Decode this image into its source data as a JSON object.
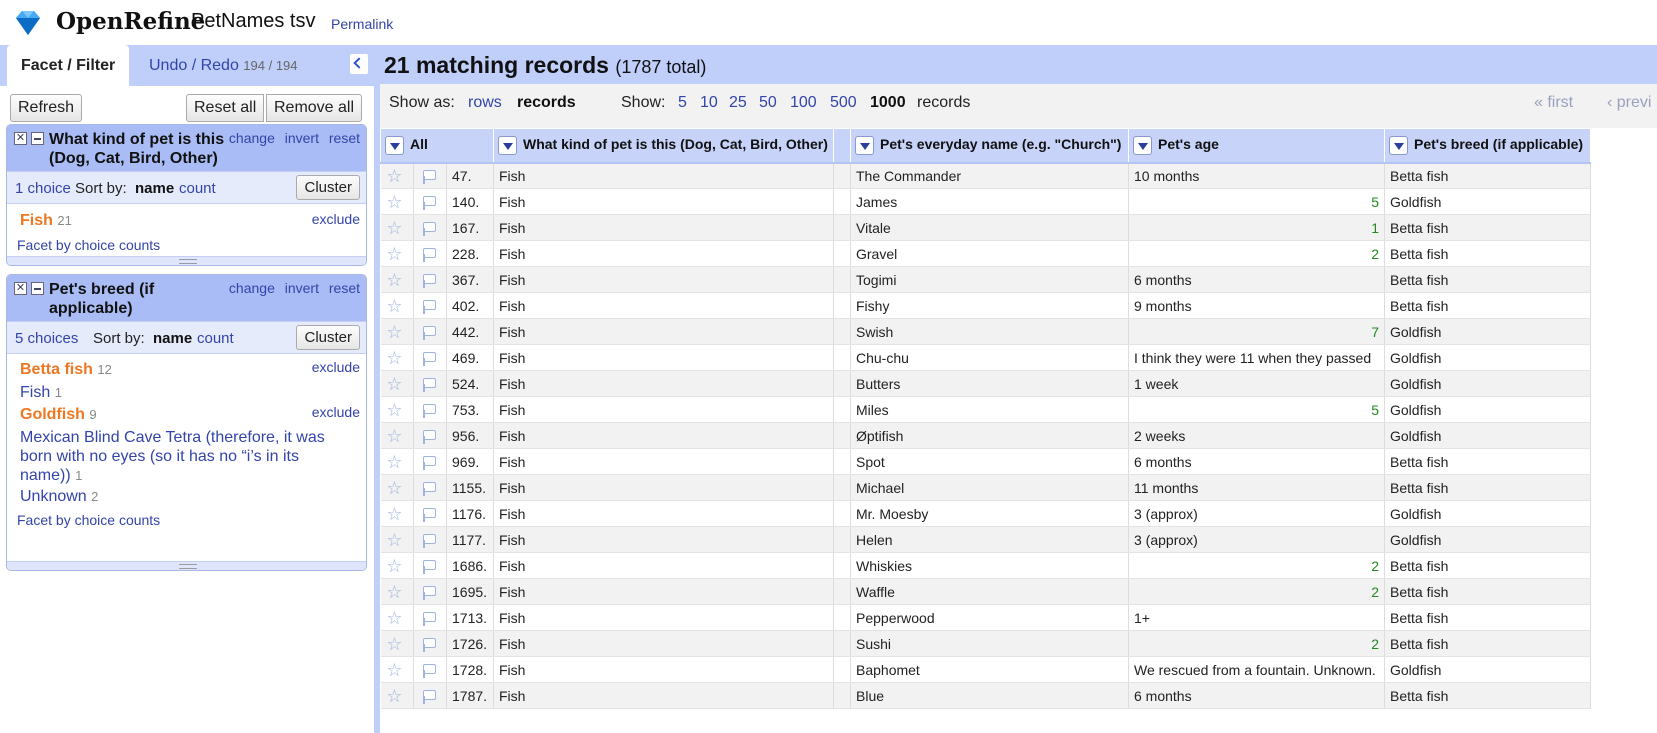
{
  "header": {
    "app_name": "OpenRefine",
    "project_name": "PetNames tsv",
    "permalink": "Permalink"
  },
  "left_panel": {
    "tabs": {
      "facet": "Facet / Filter",
      "undo": "Undo / Redo",
      "undo_count": "194 / 194"
    },
    "refresh": "Refresh",
    "reset_all": "Reset all",
    "remove_all": "Remove all",
    "facets": [
      {
        "title": "What kind of pet is this (Dog, Cat, Bird, Other)",
        "links": {
          "change": "change",
          "invert": "invert",
          "reset": "reset"
        },
        "choice_count": "1 choice",
        "sort_by": "Sort by:",
        "sort_name": "name",
        "sort_count": "count",
        "cluster": "Cluster",
        "choices": [
          {
            "label": "Fish",
            "count": "21",
            "exclude": "exclude"
          }
        ],
        "facet_by_counts": "Facet by choice counts"
      },
      {
        "title": "Pet's breed (if applicable)",
        "links": {
          "change": "change",
          "invert": "invert",
          "reset": "reset"
        },
        "choice_count": "5 choices",
        "sort_by": "Sort by:",
        "sort_name": "name",
        "sort_count": "count",
        "cluster": "Cluster",
        "choices": [
          {
            "label": "Betta fish",
            "count": "12",
            "exclude": "exclude"
          },
          {
            "label": "Fish",
            "count": "1"
          },
          {
            "label": "Goldfish",
            "count": "9",
            "exclude": "exclude"
          },
          {
            "label": "Mexican Blind Cave Tetra (therefore, it was born with no eyes (so it has no “i’s in its name))",
            "count": "1"
          },
          {
            "label": "Unknown",
            "count": "2"
          }
        ],
        "facet_by_counts": "Facet by choice counts"
      }
    ]
  },
  "summary": {
    "count": "21 matching records",
    "total": "(1787 total)"
  },
  "view_bar": {
    "show_as": "Show as:",
    "rows": "rows",
    "records": "records",
    "show": "Show:",
    "page_sizes": [
      "5",
      "10",
      "25",
      "50",
      "100",
      "500",
      "1000"
    ],
    "records_label": "records",
    "first": "« first",
    "prev": "‹ previ"
  },
  "grid": {
    "all": "All",
    "columns": [
      "What kind of pet is this (Dog, Cat, Bird, Other)",
      "Pet's everyday name (e.g. \"Church\")",
      "Pet's age",
      "Pet's breed (if applicable)"
    ],
    "rows": [
      {
        "n": "47.",
        "kind": "Fish",
        "name": "The Commander",
        "age": "10 months",
        "age_num": false,
        "breed": "Betta fish"
      },
      {
        "n": "140.",
        "kind": "Fish",
        "name": "James",
        "age": "5",
        "age_num": true,
        "breed": "Goldfish"
      },
      {
        "n": "167.",
        "kind": "Fish",
        "name": "Vitale",
        "age": "1",
        "age_num": true,
        "breed": "Betta fish"
      },
      {
        "n": "228.",
        "kind": "Fish",
        "name": "Gravel",
        "age": "2",
        "age_num": true,
        "breed": "Betta fish"
      },
      {
        "n": "367.",
        "kind": "Fish",
        "name": "Togimi",
        "age": "6 months",
        "age_num": false,
        "breed": "Betta fish"
      },
      {
        "n": "402.",
        "kind": "Fish",
        "name": "Fishy",
        "age": "9 months",
        "age_num": false,
        "breed": "Betta fish"
      },
      {
        "n": "442.",
        "kind": "Fish",
        "name": "Swish",
        "age": "7",
        "age_num": true,
        "breed": "Goldfish"
      },
      {
        "n": "469.",
        "kind": "Fish",
        "name": "Chu-chu",
        "age": "I think they were 11 when they passed",
        "age_num": false,
        "breed": "Goldfish"
      },
      {
        "n": "524.",
        "kind": "Fish",
        "name": "Butters",
        "age": "1 week",
        "age_num": false,
        "breed": "Goldfish"
      },
      {
        "n": "753.",
        "kind": "Fish",
        "name": "Miles",
        "age": "5",
        "age_num": true,
        "breed": "Goldfish"
      },
      {
        "n": "956.",
        "kind": "Fish",
        "name": "Øptifish",
        "age": "2 weeks",
        "age_num": false,
        "breed": "Goldfish"
      },
      {
        "n": "969.",
        "kind": "Fish",
        "name": "Spot",
        "age": "6 months",
        "age_num": false,
        "breed": "Betta fish"
      },
      {
        "n": "1155.",
        "kind": "Fish",
        "name": "Michael",
        "age": "11 months",
        "age_num": false,
        "breed": "Betta fish"
      },
      {
        "n": "1176.",
        "kind": "Fish",
        "name": "Mr. Moesby",
        "age": "3  (approx)",
        "age_num": false,
        "breed": "Goldfish"
      },
      {
        "n": "1177.",
        "kind": "Fish",
        "name": "Helen",
        "age": "3  (approx)",
        "age_num": false,
        "breed": "Goldfish"
      },
      {
        "n": "1686.",
        "kind": "Fish",
        "name": "Whiskies",
        "age": "2",
        "age_num": true,
        "breed": "Betta fish"
      },
      {
        "n": "1695.",
        "kind": "Fish",
        "name": "Waffle",
        "age": "2",
        "age_num": true,
        "breed": "Betta fish"
      },
      {
        "n": "1713.",
        "kind": "Fish",
        "name": "Pepperwood",
        "age": "1+",
        "age_num": false,
        "breed": "Betta fish"
      },
      {
        "n": "1726.",
        "kind": "Fish",
        "name": "Sushi",
        "age": "2",
        "age_num": true,
        "breed": "Betta fish"
      },
      {
        "n": "1728.",
        "kind": "Fish",
        "name": "Baphomet",
        "age": "We rescued from a fountain. Unknown.",
        "age_num": false,
        "breed": "Goldfish"
      },
      {
        "n": "1787.",
        "kind": "Fish",
        "name": "Blue",
        "age": "6 months",
        "age_num": false,
        "breed": "Betta fish"
      }
    ]
  }
}
